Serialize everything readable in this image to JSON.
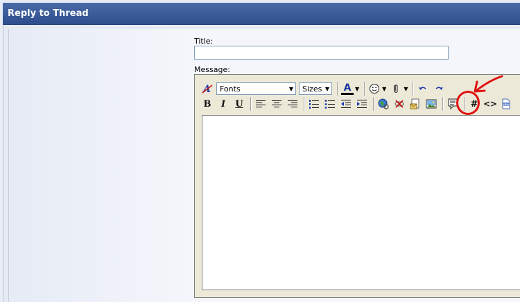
{
  "header": {
    "title": "Reply to Thread"
  },
  "form": {
    "title_label": "Title:",
    "title_value": "",
    "message_label": "Message:"
  },
  "toolbar": {
    "fonts_label": "Fonts",
    "sizes_label": "Sizes",
    "bold": "B",
    "italic": "I",
    "underline": "U",
    "font_color_letter": "A",
    "code_tag": "#",
    "html_tag": "<>"
  },
  "editor": {
    "content": ""
  },
  "colors": {
    "header": "#2e4d8c",
    "annotation": "#e01010"
  }
}
